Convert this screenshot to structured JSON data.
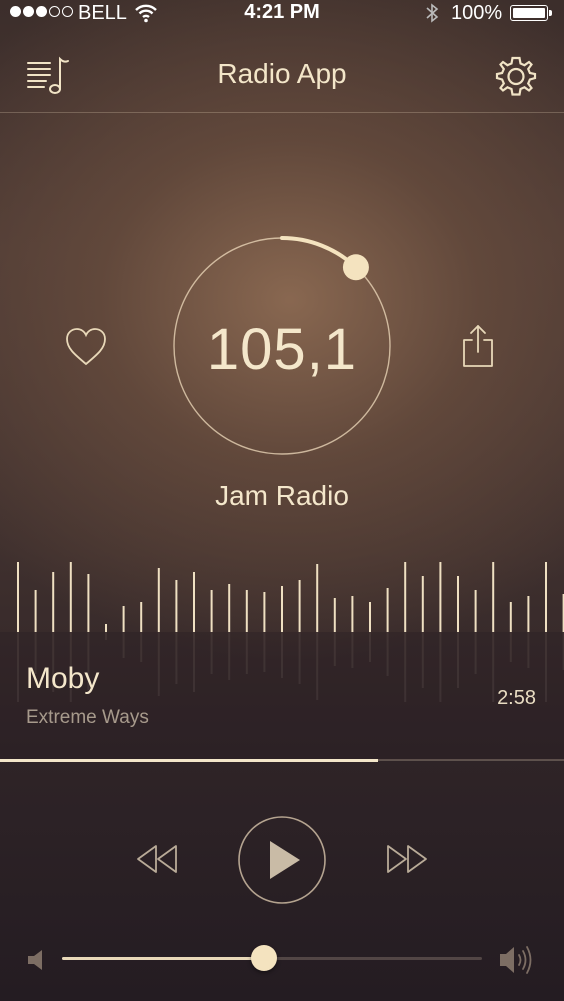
{
  "status_bar": {
    "signal_full": 3,
    "signal_total": 5,
    "carrier": "BELL",
    "time": "4:21 PM",
    "battery": "100%"
  },
  "header": {
    "title": "Radio App",
    "menu_icon": "playlist-music-icon",
    "settings_icon": "gear-icon"
  },
  "tuner": {
    "frequency": "105,1",
    "station": "Jam Radio",
    "dial_level": 0.12,
    "favorite_icon": "heart-icon",
    "share_icon": "share-icon"
  },
  "now_playing": {
    "artist": "Moby",
    "track": "Extreme Ways",
    "duration": "2:58",
    "progress": 0.67
  },
  "controls": {
    "rewind_icon": "rewind-icon",
    "play_icon": "play-icon",
    "forward_icon": "fast-forward-icon"
  },
  "volume": {
    "level": 0.48,
    "low_icon": "volume-low-icon",
    "high_icon": "volume-high-icon"
  },
  "colors": {
    "accent": "#f3e6c9",
    "background_top": "#3c2e2b",
    "background_bottom": "#241c22"
  }
}
